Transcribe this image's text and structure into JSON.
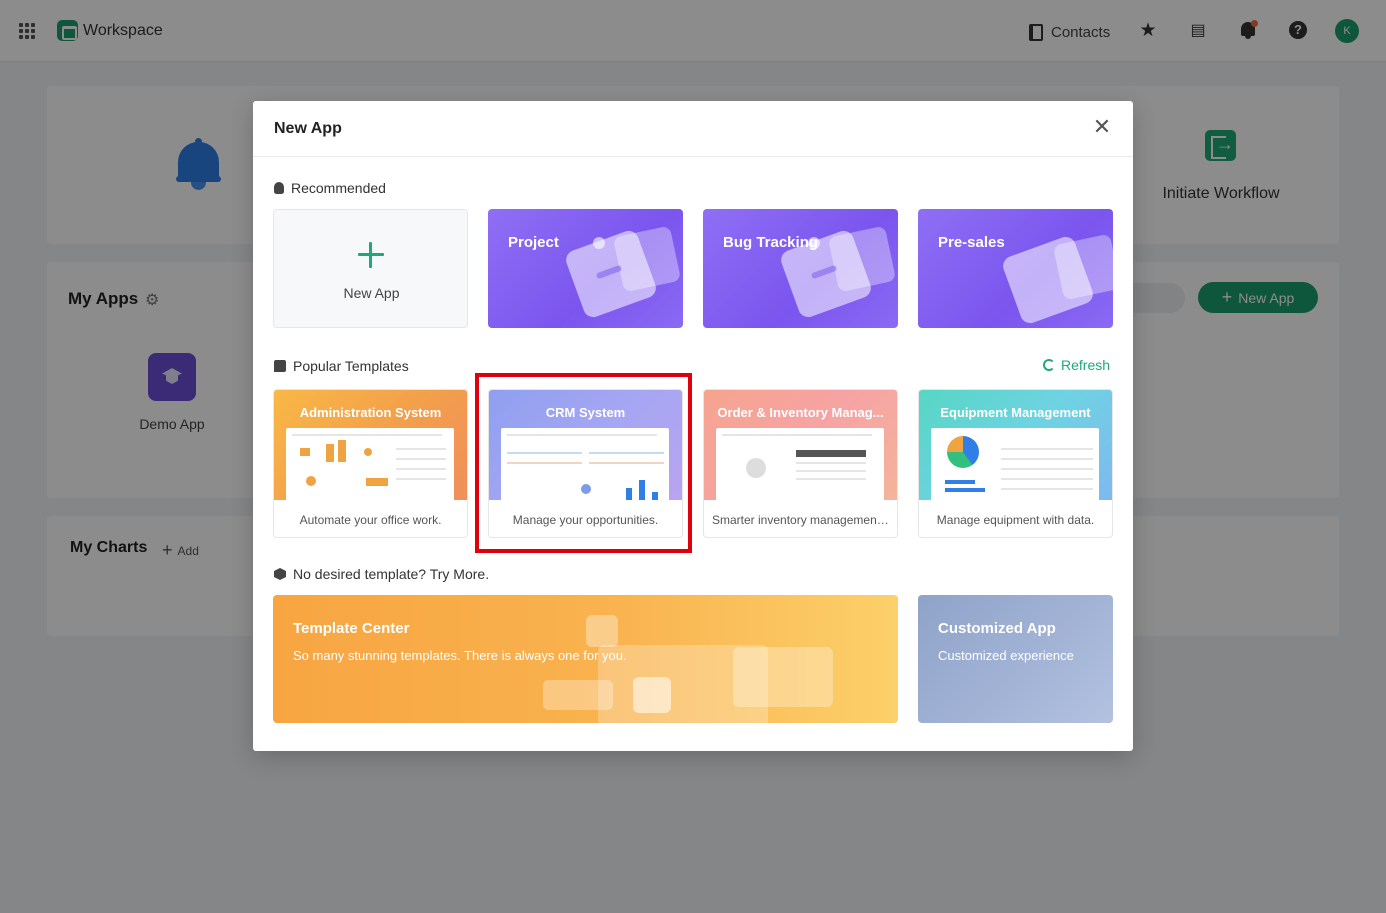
{
  "topbar": {
    "title": "Workspace",
    "contacts_label": "Contacts",
    "avatar_letter": "K"
  },
  "background": {
    "initiate_workflow": "Initiate Workflow",
    "my_apps_title": "My Apps",
    "demo_app_label": "Demo App",
    "new_app_button": "New App",
    "my_charts_title": "My Charts",
    "my_charts_add": "Add"
  },
  "modal": {
    "title": "New App",
    "recommended_label": "Recommended",
    "new_app_card_label": "New App",
    "recommended_cards": [
      {
        "title": "Project"
      },
      {
        "title": "Bug Tracking"
      },
      {
        "title": "Pre-sales"
      }
    ],
    "popular_label": "Popular Templates",
    "refresh_label": "Refresh",
    "templates": [
      {
        "title": "Administration System",
        "desc": "Automate your office work."
      },
      {
        "title": "CRM System",
        "desc": "Manage your opportunities."
      },
      {
        "title": "Order & Inventory Manag...",
        "desc": "Smarter inventory management..."
      },
      {
        "title": "Equipment Management",
        "desc": "Manage equipment with data."
      }
    ],
    "more_label": "No desired template? Try More.",
    "template_center": {
      "title": "Template Center",
      "subtitle": "So many stunning templates. There is always one for you."
    },
    "customized_app": {
      "title": "Customized App",
      "subtitle": "Customized experience"
    }
  },
  "colors": {
    "brand_green": "#1a9e6e",
    "purple_card": "#7b55ee",
    "highlight_red": "#e0000d"
  }
}
